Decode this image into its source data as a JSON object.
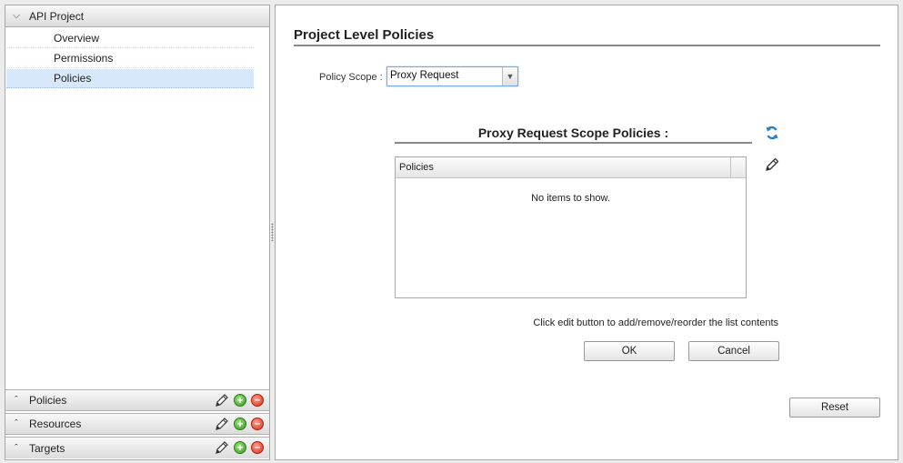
{
  "left_panel": {
    "project": {
      "label": "API Project",
      "expanded": true,
      "icon": "chevron-down-icon"
    },
    "tree_items": [
      {
        "label": "Overview",
        "selected": false
      },
      {
        "label": "Permissions",
        "selected": false
      },
      {
        "label": "Policies",
        "selected": true
      }
    ],
    "sections": [
      {
        "label": "Policies",
        "icon": "chevron-up-icon"
      },
      {
        "label": "Resources",
        "icon": "chevron-up-icon"
      },
      {
        "label": "Targets",
        "icon": "chevron-up-icon"
      }
    ],
    "section_tools": [
      "pencil-icon",
      "add-icon",
      "remove-icon"
    ]
  },
  "main": {
    "title": "Project Level Policies",
    "policy_scope": {
      "label": "Policy Scope :",
      "value": "Proxy Request"
    },
    "list": {
      "title": "Proxy Request Scope Policies :",
      "column": "Policies",
      "empty_text": "No items to show."
    },
    "hint": "Click edit button to add/remove/reorder the list contents",
    "buttons": {
      "ok": "OK",
      "cancel": "Cancel",
      "reset": "Reset"
    }
  },
  "colors": {
    "selected_row": "#d8e8fb",
    "select_focus_border": "#7aa7e6",
    "add_green": "#3c9a22",
    "remove_red": "#d8311a",
    "refresh_blue": "#2f7fc8"
  }
}
